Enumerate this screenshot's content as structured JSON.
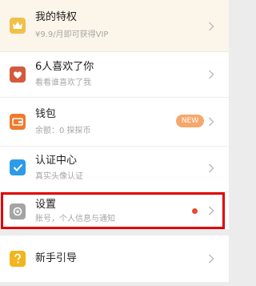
{
  "menu": {
    "vip": {
      "title": "我的特权",
      "subtitle": "¥9.9/月即可获得VIP",
      "icon": "crown-icon",
      "icon_color": "#f1c046"
    },
    "likes": {
      "title": "6人喜欢了你",
      "subtitle": "看看谁喜欢了我",
      "icon": "heart-icon",
      "icon_color": "#d35a3d"
    },
    "wallet": {
      "title": "钱包",
      "subtitle": "余额：0 探探币",
      "badge": "NEW",
      "icon": "wallet-icon",
      "icon_color": "#f07a2e",
      "badge_color": "#f6a76c"
    },
    "verify": {
      "title": "认证中心",
      "subtitle": "真实头像认证",
      "icon": "check-icon",
      "icon_color": "#2f9be6"
    },
    "settings": {
      "title": "设置",
      "subtitle": "账号，个人信息与通知",
      "icon": "gear-icon",
      "icon_color": "#a4a4a4",
      "has_notification_dot": true,
      "dot_color": "#e84a2c"
    },
    "guide": {
      "title": "新手引导",
      "icon": "question-icon",
      "icon_color": "#f2b51d"
    }
  },
  "highlight_color": "#e10000"
}
